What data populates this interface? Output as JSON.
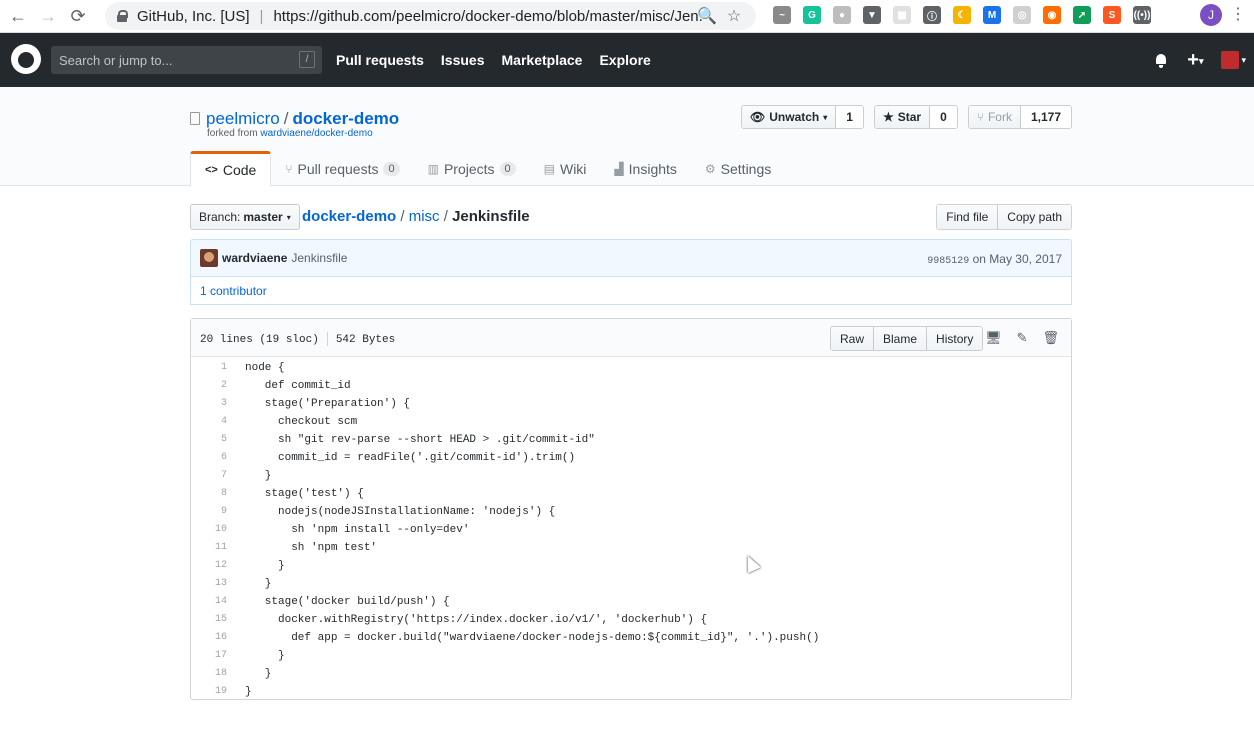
{
  "browser": {
    "site": "GitHub, Inc. [US]",
    "url": "https://github.com/peelmicro/docker-demo/blob/master/misc/Jen...",
    "profile_initial": "J",
    "extensions": [
      {
        "name": "ext-1",
        "color": "#8a8a8a",
        "glyph": "~"
      },
      {
        "name": "grammarly",
        "color": "#15c39a",
        "glyph": "G"
      },
      {
        "name": "ext-3",
        "color": "#bdbdbd",
        "glyph": "●"
      },
      {
        "name": "ext-4",
        "color": "#5f6368",
        "glyph": "▼"
      },
      {
        "name": "ext-5",
        "color": "#e0e0e0",
        "glyph": "▦"
      },
      {
        "name": "ext-6",
        "color": "#5f6368",
        "glyph": "ⓘ"
      },
      {
        "name": "ext-7",
        "color": "#f4b400",
        "glyph": "☾"
      },
      {
        "name": "ext-8",
        "color": "#1a73e8",
        "glyph": "M"
      },
      {
        "name": "ext-9",
        "color": "#d0d0d0",
        "glyph": "◎"
      },
      {
        "name": "ext-10",
        "color": "#ff6d00",
        "glyph": "◉"
      },
      {
        "name": "ext-11",
        "color": "#0f9d58",
        "glyph": "➚"
      },
      {
        "name": "ext-12",
        "color": "#ff5722",
        "glyph": "S"
      },
      {
        "name": "ext-13",
        "color": "#5f6368",
        "glyph": "((•))"
      }
    ]
  },
  "gh_header": {
    "search_placeholder": "Search or jump to...",
    "search_key": "/",
    "nav": [
      "Pull requests",
      "Issues",
      "Marketplace",
      "Explore"
    ]
  },
  "repo": {
    "owner": "peelmicro",
    "name": "docker-demo",
    "forked_prefix": "forked from ",
    "forked_from": "wardviaene/docker-demo",
    "watch_label": "Unwatch",
    "watch_count": "1",
    "star_label": "Star",
    "star_count": "0",
    "fork_label": "Fork",
    "fork_count": "1,177",
    "tabs": [
      {
        "label": "Code",
        "counter": null
      },
      {
        "label": "Pull requests",
        "counter": "0"
      },
      {
        "label": "Projects",
        "counter": "0"
      },
      {
        "label": "Wiki",
        "counter": null
      },
      {
        "label": "Insights",
        "counter": null
      },
      {
        "label": "Settings",
        "counter": null
      }
    ]
  },
  "file_nav": {
    "branch_prefix": "Branch:",
    "branch": "master",
    "path_root": "docker-demo",
    "path_dir": "misc",
    "path_file": "Jenkinsfile",
    "find_file": "Find file",
    "copy_path": "Copy path"
  },
  "commit": {
    "author": "wardviaene",
    "message": "Jenkinsfile",
    "sha": "9985129",
    "date": "on May 30, 2017",
    "contributors": "1 contributor"
  },
  "file": {
    "lines_info": "20 lines (19 sloc)",
    "size": "542 Bytes",
    "raw": "Raw",
    "blame": "Blame",
    "history": "History",
    "code": [
      "node {",
      "   def commit_id",
      "   stage('Preparation') {",
      "     checkout scm",
      "     sh \"git rev-parse --short HEAD > .git/commit-id\"",
      "     commit_id = readFile('.git/commit-id').trim()",
      "   }",
      "   stage('test') {",
      "     nodejs(nodeJSInstallationName: 'nodejs') {",
      "       sh 'npm install --only=dev'",
      "       sh 'npm test'",
      "     }",
      "   }",
      "   stage('docker build/push') {",
      "     docker.withRegistry('https://index.docker.io/v1/', 'dockerhub') {",
      "       def app = docker.build(\"wardviaene/docker-nodejs-demo:${commit_id}\", '.').push()",
      "     }",
      "   }",
      "}"
    ]
  }
}
